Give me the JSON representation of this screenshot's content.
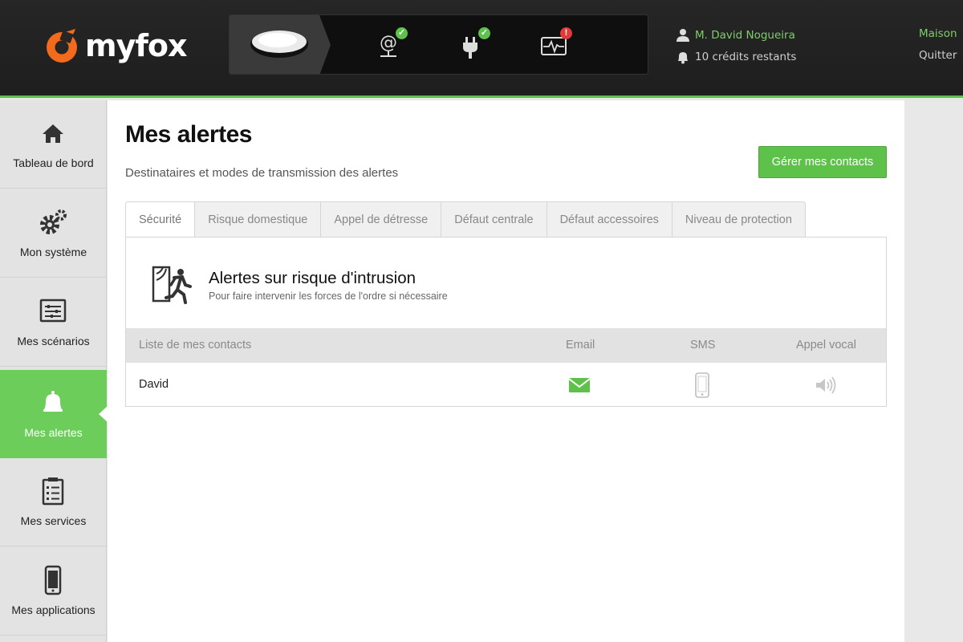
{
  "header": {
    "logo_text": "myfox",
    "status_icons": [
      {
        "name": "internet-status-icon",
        "state": "ok"
      },
      {
        "name": "power-status-icon",
        "state": "ok"
      },
      {
        "name": "monitor-status-icon",
        "state": "error"
      }
    ],
    "user_name": "M. David Nogueira",
    "credits": "10 crédits restants",
    "home_label": "Maison",
    "logout_label": "Quitter",
    "colors": {
      "accent": "#5cc24c",
      "error": "#e23a3a",
      "background": "#1e1e1e"
    }
  },
  "sidebar": {
    "items": [
      {
        "label": "Tableau de bord",
        "icon": "home-icon",
        "active": false
      },
      {
        "label": "Mon système",
        "icon": "gears-icon",
        "active": false
      },
      {
        "label": "Mes scénarios",
        "icon": "sliders-icon",
        "active": false
      },
      {
        "label": "Mes alertes",
        "icon": "bell-icon",
        "active": true
      },
      {
        "label": "Mes services",
        "icon": "checklist-icon",
        "active": false
      },
      {
        "label": "Mes applications",
        "icon": "phone-icon",
        "active": false
      }
    ]
  },
  "main": {
    "title": "Mes alertes",
    "subtitle": "Destinataires et modes de transmission des alertes",
    "manage_contacts_button": "Gérer mes contacts",
    "tabs": [
      {
        "label": "Sécurité",
        "active": true
      },
      {
        "label": "Risque domestique",
        "active": false
      },
      {
        "label": "Appel de détresse",
        "active": false
      },
      {
        "label": "Défaut centrale",
        "active": false
      },
      {
        "label": "Défaut accessoires",
        "active": false
      },
      {
        "label": "Niveau de protection",
        "active": false
      }
    ],
    "alert": {
      "title": "Alertes sur risque d'intrusion",
      "description": "Pour faire intervenir les forces de l'ordre si nécessaire"
    },
    "table": {
      "columns": [
        "Liste de mes contacts",
        "Email",
        "SMS",
        "Appel vocal"
      ],
      "rows": [
        {
          "contact": "David",
          "email": "enabled",
          "sms": "disabled",
          "voice": "disabled"
        }
      ]
    }
  }
}
